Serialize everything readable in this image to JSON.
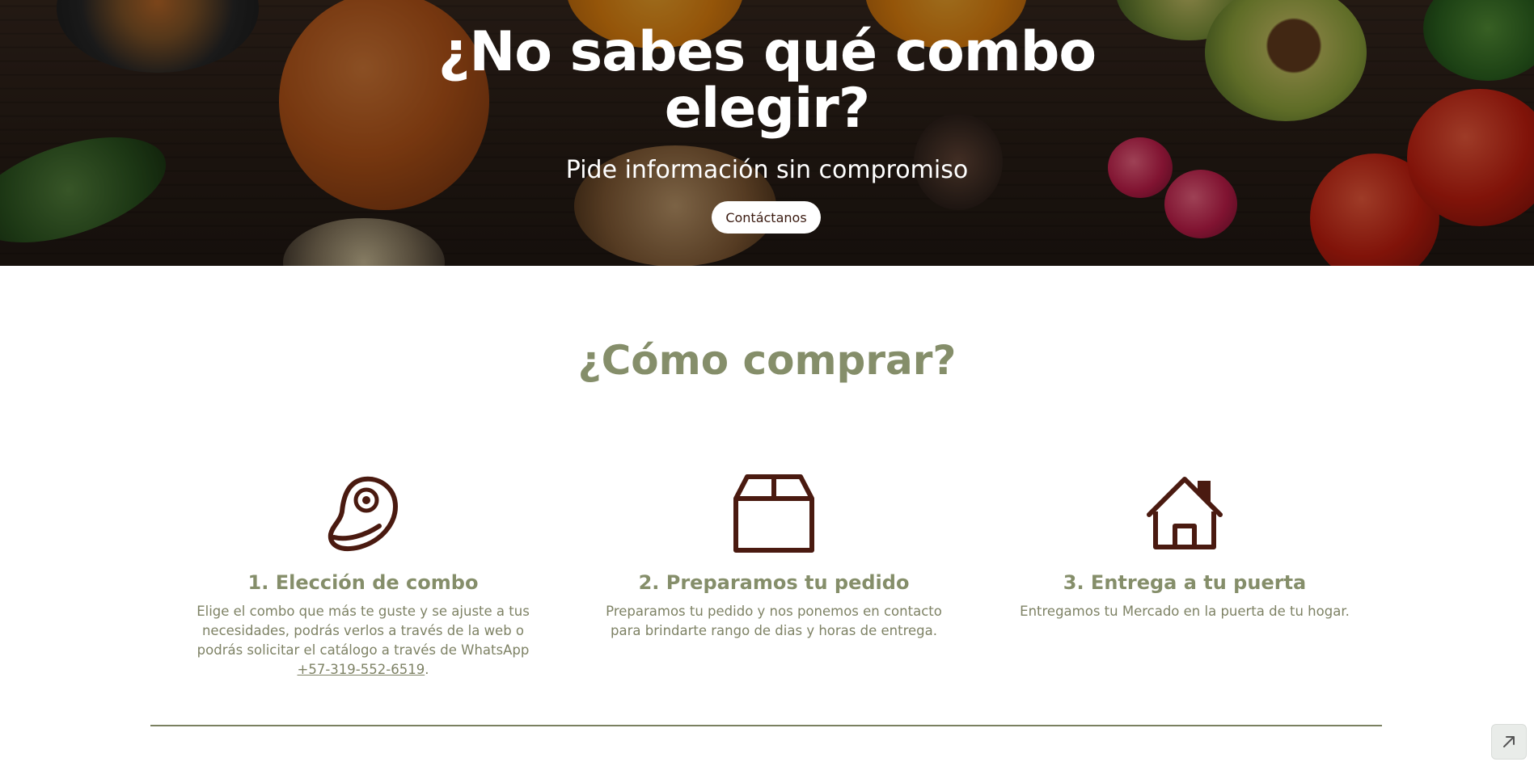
{
  "hero": {
    "title_line1": "¿No sabes qué combo",
    "title_line2": "elegir?",
    "subtitle": "Pide información sin compromiso",
    "cta_label": "Contáctanos"
  },
  "how_to_buy": {
    "title": "¿Cómo comprar?",
    "steps": [
      {
        "icon": "meat-steak-icon",
        "title": "1. Elección de combo",
        "description": "Elige el combo que más te guste y se ajuste a tus necesidades, podrás verlos a través de la web o podrás solicitar el catálogo a través de WhatsApp ",
        "link_text": "+57-319-552-6519",
        "description_end": "."
      },
      {
        "icon": "box-package-icon",
        "title": "2. Preparamos tu pedido",
        "description": "Preparamos tu pedido y nos ponemos en contacto para brindarte rango de dias y horas de entrega."
      },
      {
        "icon": "house-icon",
        "title": "3. Entrega a tu puerta",
        "description": "Entregamos tu Mercado en la puerta de tu hogar."
      }
    ]
  },
  "corner_button": {
    "icon": "arrow-up-right-icon"
  },
  "colors": {
    "accent_olive": "#858e6a",
    "icon_brown": "#4a1a10",
    "hero_dark": "#2c2018"
  }
}
